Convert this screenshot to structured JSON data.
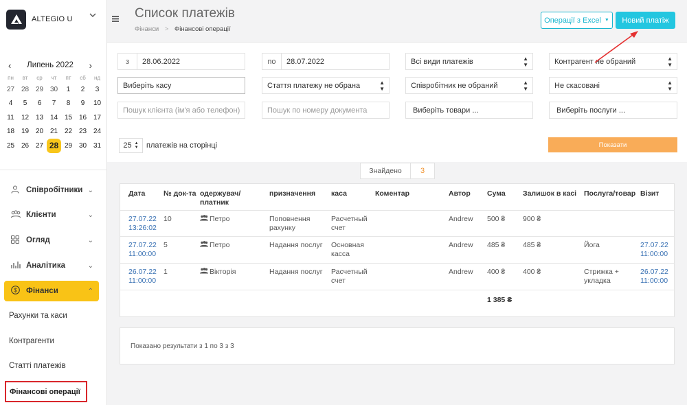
{
  "brand": {
    "name": "ALTEGIO U"
  },
  "calendar": {
    "month_label": "Липень 2022",
    "weekdays": [
      "пн",
      "вт",
      "ср",
      "чт",
      "пт",
      "сб",
      "нд"
    ],
    "days": [
      [
        "27",
        "28",
        "29",
        "30",
        "1",
        "2",
        "3"
      ],
      [
        "4",
        "5",
        "6",
        "7",
        "8",
        "9",
        "10"
      ],
      [
        "11",
        "12",
        "13",
        "14",
        "15",
        "16",
        "17"
      ],
      [
        "18",
        "19",
        "20",
        "21",
        "22",
        "23",
        "24"
      ],
      [
        "25",
        "26",
        "27",
        "28",
        "29",
        "30",
        "31"
      ]
    ],
    "selected": "28"
  },
  "nav": {
    "employees": "Співробітники",
    "clients": "Клієнти",
    "overview": "Огляд",
    "analytics": "Аналітика",
    "finance": "Фінанси",
    "sub": {
      "accounts": "Рахунки та каси",
      "counterparties": "Контрагенти",
      "items": "Статті платежів",
      "operations": "Фінансові операції"
    }
  },
  "header": {
    "title": "Список платежів",
    "breadcrumb": [
      "Фінанси",
      "Фінансові операції"
    ],
    "excel_button": "Операції з Excel",
    "new_button": "Новий платіж"
  },
  "filters": {
    "from_prefix": "з",
    "from_date": "28.06.2022",
    "to_prefix": "по",
    "to_date": "28.07.2022",
    "payment_type": "Всі види платежів",
    "counterparty": "Контрагент не обраний",
    "cashbox": "Виберіть касу",
    "item": "Стаття платежу не обрана",
    "employee": "Співробітник не обраний",
    "cancelled": "Не скасовані",
    "client_search_placeholder": "Пошук клієнта (ім'я або телефон)",
    "doc_search_placeholder": "Пошук по номеру документа",
    "goods": "Виберіть товари ...",
    "services": "Виберіть послуги ...",
    "per_page": "25",
    "per_page_label": "платежів на сторінці",
    "show_button": "Показати"
  },
  "found": {
    "label": "Знайдено",
    "count": "3"
  },
  "table": {
    "headers": {
      "date": "Дата",
      "doc": "№ док-та",
      "payee1": "одержувач/",
      "payee2": "платник",
      "purpose": "призначення",
      "cashbox": "каса",
      "comment": "Коментар",
      "author": "Автор",
      "sum": "Сума",
      "balance": "Залишок в касі",
      "service": "Послуга/товар",
      "visit": "Візит"
    },
    "rows": [
      {
        "date1": "27.07.22",
        "date2": "13:26:02",
        "doc": "10",
        "payee": "Петро",
        "purpose1": "Поповнення",
        "purpose2": "рахунку",
        "cash1": "Расчетный",
        "cash2": "счет",
        "author": "Andrew",
        "sum": "500 ₴",
        "balance": "900 ₴",
        "service1": "",
        "service2": "",
        "visit1": "",
        "visit2": ""
      },
      {
        "date1": "27.07.22",
        "date2": "11:00:00",
        "doc": "5",
        "payee": "Петро",
        "purpose1": "Надання послуг",
        "purpose2": "",
        "cash1": "Основная",
        "cash2": "касса",
        "author": "Andrew",
        "sum": "485 ₴",
        "balance": "485 ₴",
        "service1": "Йога",
        "service2": "",
        "visit1": "27.07.22",
        "visit2": "11:00:00"
      },
      {
        "date1": "26.07.22",
        "date2": "11:00:00",
        "doc": "1",
        "payee": "Вікторія",
        "purpose1": "Надання послуг",
        "purpose2": "",
        "cash1": "Расчетный",
        "cash2": "счет",
        "author": "Andrew",
        "sum": "400 ₴",
        "balance": "400 ₴",
        "service1": "Стрижка +",
        "service2": "укладка",
        "visit1": "26.07.22",
        "visit2": "11:00:00"
      }
    ],
    "total": "1 385 ₴"
  },
  "results": "Показано результати з 1 по 3 з 3",
  "colors": {
    "accent": "#f9c316",
    "primary": "#23c6e0",
    "show": "#f9ac58",
    "highlight": "#d9262b"
  }
}
